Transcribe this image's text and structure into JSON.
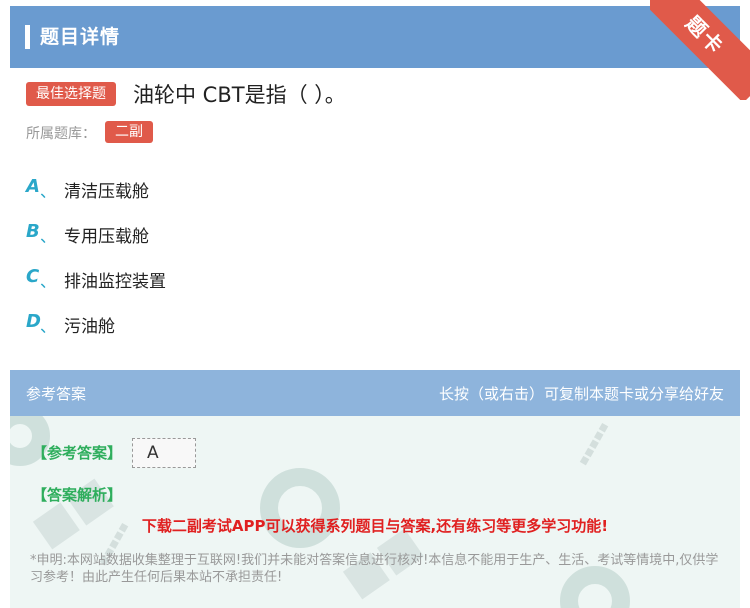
{
  "header": {
    "title": "题目详情",
    "corner_badge": "题卡"
  },
  "question": {
    "type_tag": "最佳选择题",
    "text": "油轮中 CBT是指（   ）。",
    "library_label": "所属题库：",
    "library_tag": "二副"
  },
  "options": [
    {
      "letter": "A",
      "sep": "、",
      "text": "清洁压载舱"
    },
    {
      "letter": "B",
      "sep": "、",
      "text": "专用压载舱"
    },
    {
      "letter": "C",
      "sep": "、",
      "text": "排油监控装置"
    },
    {
      "letter": "D",
      "sep": "、",
      "text": "污油舱"
    }
  ],
  "answer_bar": {
    "left": "参考答案",
    "right": "长按（或右击）可复制本题卡或分享给好友"
  },
  "answer_panel": {
    "ref_label": "【参考答案】",
    "ref_value": "A",
    "analysis_label": "【答案解析】",
    "promo": "下载二副考试APP可以获得系列题目与答案,还有练习等更多学习功能!",
    "disclaimer": "*申明:本网站数据收集整理于互联网!我们并未能对答案信息进行核对!本信息不能用于生产、生活、考试等情境中,仅供学习参考！由此产生任何后果本站不承担责任!"
  },
  "colors": {
    "header": "#6a9bd0",
    "answer_bar": "#8eb4dc",
    "tag_red": "#e05a4a",
    "option_letter": "#2aa7c9",
    "label_green": "#2fae5d",
    "promo_red": "#e02020"
  }
}
